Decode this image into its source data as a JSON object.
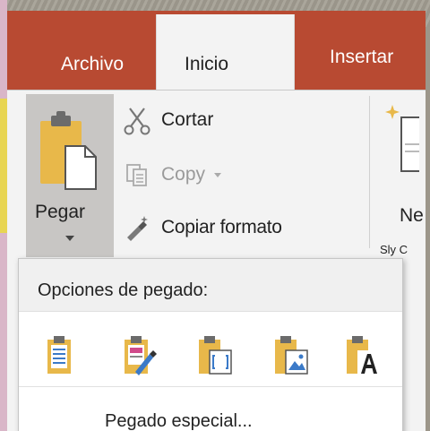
{
  "tabs": {
    "file": "Archivo",
    "home": "Inicio",
    "insert": "Insertar"
  },
  "ribbon": {
    "paste_label": "Pegar",
    "cut_label": "Cortar",
    "copy_label": "Copy",
    "copy_format_label": "Copiar formato",
    "new_slide_label_partial": "Ne",
    "new_slide_sub_partial": "Sly C"
  },
  "paste_menu": {
    "header": "Opciones de pegado:",
    "options": [
      {
        "icon": "paste-use-destination-theme-icon"
      },
      {
        "icon": "paste-keep-source-formatting-icon"
      },
      {
        "icon": "paste-embed-icon"
      },
      {
        "icon": "paste-picture-icon"
      },
      {
        "icon": "paste-keep-text-only-icon"
      }
    ],
    "special": "Pegado especial..."
  },
  "colors": {
    "tab_bar": "#b84a32",
    "ribbon_bg": "#f3f3f3",
    "clipboard_gold": "#e8b84a",
    "pressed_gray": "#c8c6c4"
  }
}
